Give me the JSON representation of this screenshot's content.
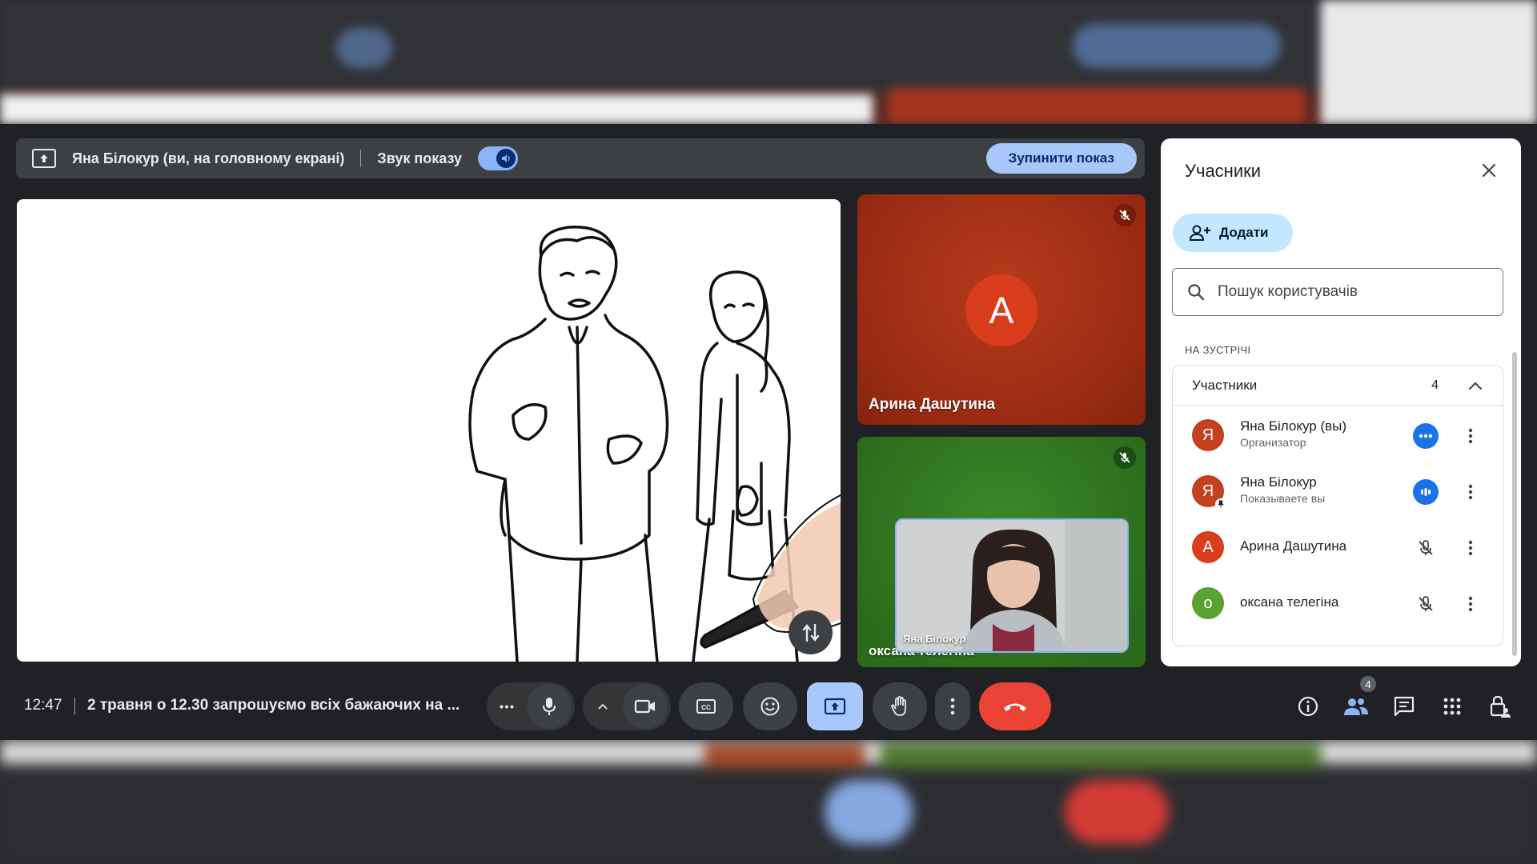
{
  "presenting_bar": {
    "title": "Яна Білокур (ви, на головному екрані)",
    "sound_label": "Звук показу",
    "sound_on": true,
    "stop_label": "Зупинити показ"
  },
  "tiles": [
    {
      "name": "Арина Дашутина",
      "initial": "А",
      "muted": true,
      "color": "#d93d1c"
    },
    {
      "name": "оксана телегіна",
      "muted": true
    }
  ],
  "self_view": {
    "name": "Яна Білокур"
  },
  "bottom_bar": {
    "time": "12:47",
    "meeting_title": "2 травня о 12.30 запрошуємо всіх бажаючих на ...",
    "people_count": "4"
  },
  "panel": {
    "title": "Учасники",
    "add_label": "Додати",
    "search_placeholder": "Пошук користувачів",
    "section_label": "НА ЗУСТРІЧІ",
    "group_label": "Участники",
    "group_count": "4",
    "participants": [
      {
        "initial": "Я",
        "name": "Яна Білокур (вы)",
        "role": "Организатор",
        "color": "#c5401f",
        "status": "more-active"
      },
      {
        "initial": "Я",
        "name": "Яна Білокур",
        "role": "Показываете вы",
        "color": "#c5401f",
        "status": "speaking"
      },
      {
        "initial": "А",
        "name": "Арина Дашутина",
        "role": "",
        "color": "#d93d1c",
        "status": "muted"
      },
      {
        "initial": "о",
        "name": "оксана телегіна",
        "role": "",
        "color": "#5aa12f",
        "status": "muted"
      }
    ]
  },
  "colors": {
    "accent": "#a8c7fa",
    "end_call": "#ea4335",
    "panel_bg": "#ffffff",
    "meet_bg": "#202124"
  }
}
